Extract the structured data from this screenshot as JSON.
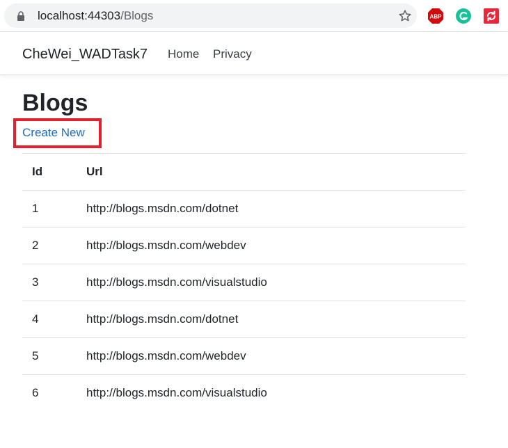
{
  "browser": {
    "url_host": "localhost:44303",
    "url_path": "/Blogs",
    "extensions": [
      "adblock-plus-icon",
      "grammarly-icon",
      "sync-icon"
    ]
  },
  "nav": {
    "brand": "CheWei_WADTask7",
    "links": [
      "Home",
      "Privacy"
    ]
  },
  "main": {
    "title": "Blogs",
    "create_link": "Create New",
    "table": {
      "headers": [
        "Id",
        "Url"
      ],
      "rows": [
        {
          "id": "1",
          "url": "http://blogs.msdn.com/dotnet"
        },
        {
          "id": "2",
          "url": "http://blogs.msdn.com/webdev"
        },
        {
          "id": "3",
          "url": "http://blogs.msdn.com/visualstudio"
        },
        {
          "id": "4",
          "url": "http://blogs.msdn.com/dotnet"
        },
        {
          "id": "5",
          "url": "http://blogs.msdn.com/webdev"
        },
        {
          "id": "6",
          "url": "http://blogs.msdn.com/visualstudio"
        }
      ]
    }
  },
  "colors": {
    "link": "#1b6ec2",
    "highlight": "#e3212d"
  }
}
